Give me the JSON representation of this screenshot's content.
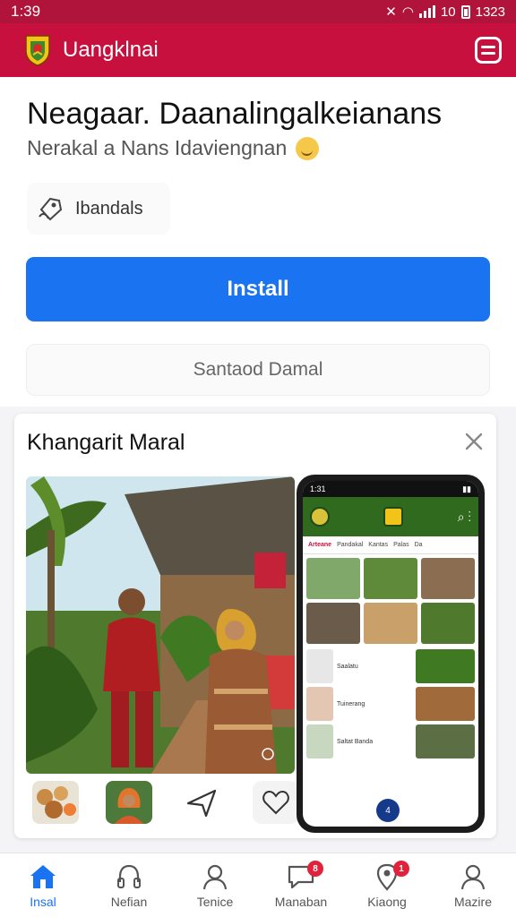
{
  "status_bar": {
    "time": "1:39",
    "right_text": "1323",
    "net_text": "10"
  },
  "app_bar": {
    "title": "Uangklnai"
  },
  "main": {
    "heading": "Neagaar. Daanalingalkeianans",
    "subheading": "Nerakal a Nans Idaviengnan",
    "tag_label": "Ibandals",
    "install_label": "Install",
    "secondary_label": "Santaod Damal"
  },
  "card": {
    "title": "Khangarit Maral",
    "phone": {
      "time": "1:31",
      "tabs": [
        "Arteane",
        "Pandakal",
        "Kantas",
        "Palas",
        "Da"
      ],
      "rows": [
        {
          "text": "Saalatu"
        },
        {
          "text": "Tuinerang"
        },
        {
          "text": "Saltat Banda"
        }
      ],
      "fab_count": "4"
    }
  },
  "bottom_nav": {
    "items": [
      {
        "label": "Insal",
        "icon": "home-icon",
        "active": true
      },
      {
        "label": "Nefian",
        "icon": "headset-icon"
      },
      {
        "label": "Tenice",
        "icon": "person-icon"
      },
      {
        "label": "Manaban",
        "icon": "chat-icon",
        "badge": "8"
      },
      {
        "label": "Kiaong",
        "icon": "map-pin-icon",
        "badge": "1"
      },
      {
        "label": "Mazire",
        "icon": "user-icon"
      }
    ]
  },
  "colors": {
    "brand": "#c8103e",
    "accent": "#1a73f0"
  }
}
